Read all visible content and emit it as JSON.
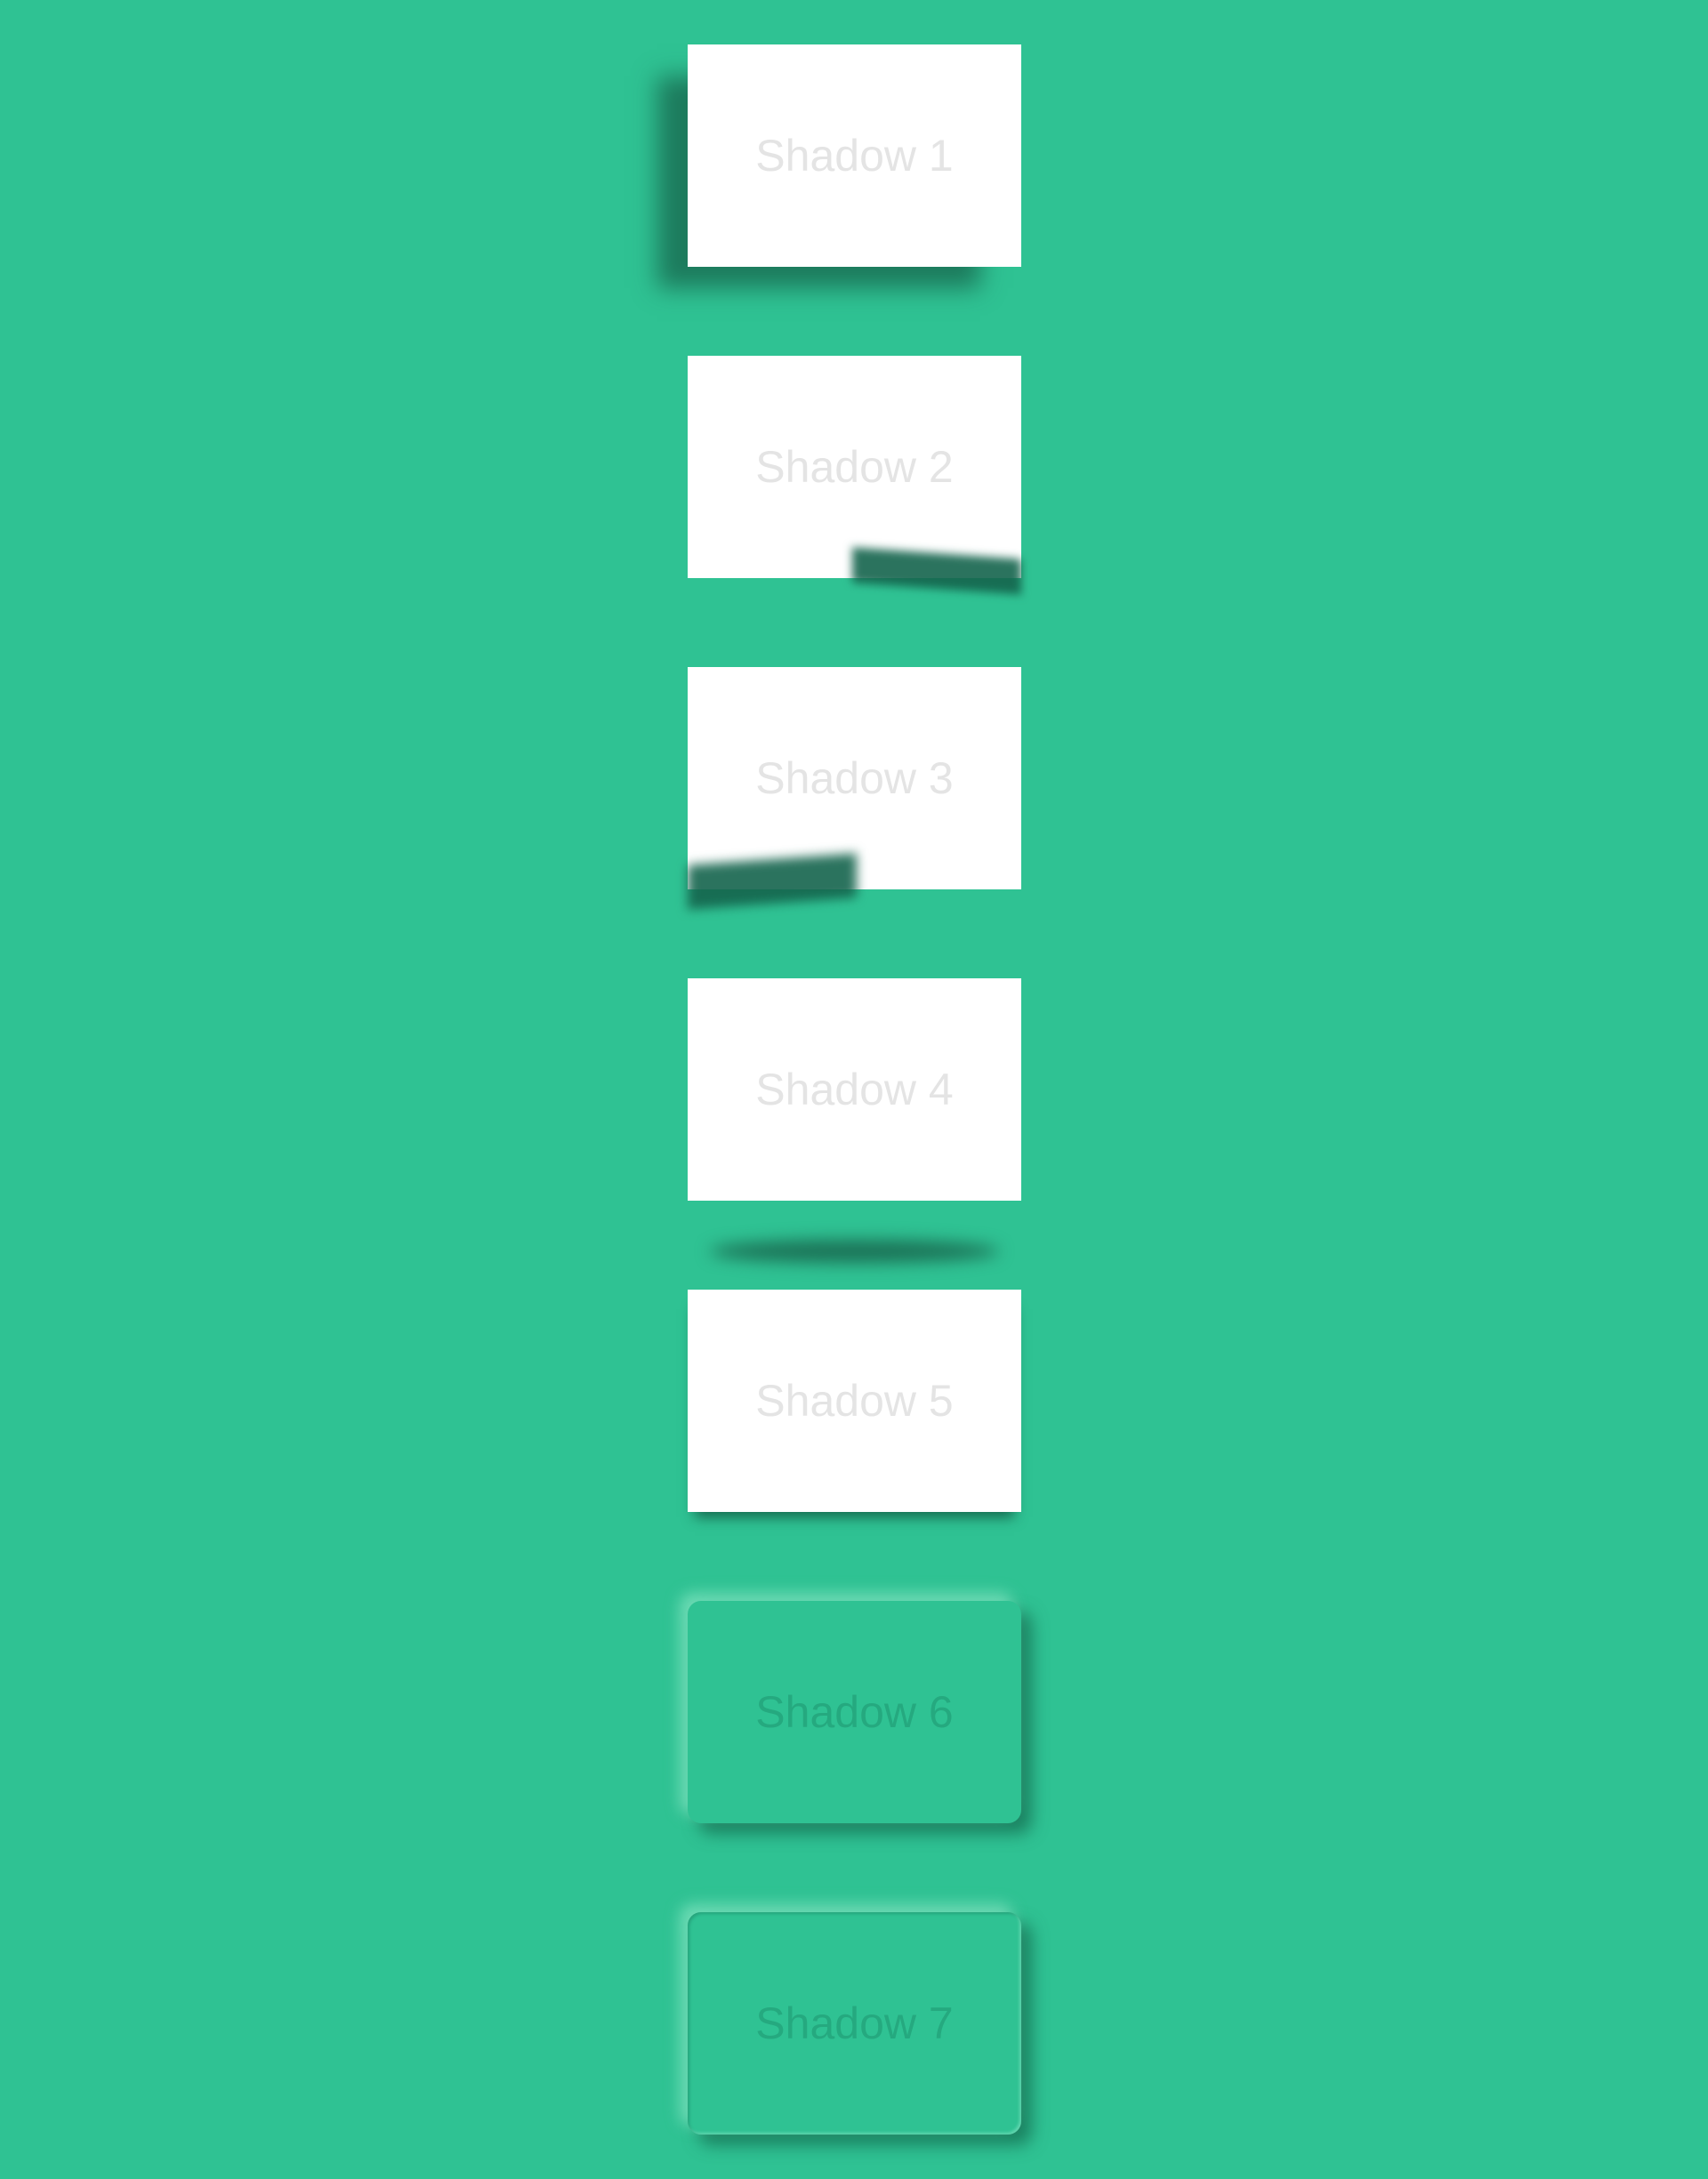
{
  "cards": [
    {
      "label": "Shadow 1"
    },
    {
      "label": "Shadow 2"
    },
    {
      "label": "Shadow 3"
    },
    {
      "label": "Shadow 4"
    },
    {
      "label": "Shadow 5"
    },
    {
      "label": "Shadow 6"
    },
    {
      "label": "Shadow 7"
    }
  ],
  "colors": {
    "background": "#2fc293",
    "card_white": "#ffffff",
    "label_on_white": "#e4e4e4",
    "label_on_green": "#25a97f",
    "shadow": "#1a6e54"
  }
}
